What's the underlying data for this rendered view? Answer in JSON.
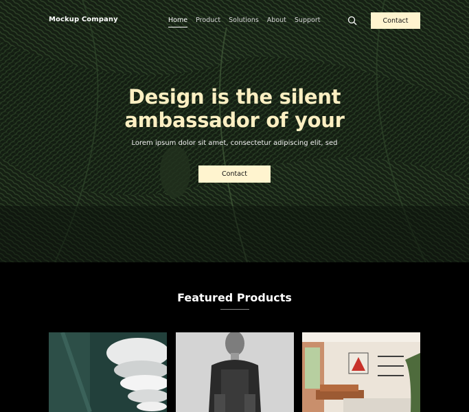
{
  "nav": {
    "brand": "Mockup Company",
    "items": [
      {
        "label": "Home",
        "active": true
      },
      {
        "label": "Product",
        "active": false
      },
      {
        "label": "Solutions",
        "active": false
      },
      {
        "label": "About",
        "active": false
      },
      {
        "label": "Support",
        "active": false
      }
    ],
    "search_icon": "search-icon",
    "contact_label": "Contact"
  },
  "hero": {
    "headline_line1": "Design is the silent",
    "headline_line2": "ambassador of your",
    "subtitle": "Lorem ipsum dolor sit amet, consectetur adipiscing elit, sed",
    "contact_label": "Contact"
  },
  "featured": {
    "title": "Featured Products",
    "products": [
      {
        "image": "pendant-lamp"
      },
      {
        "image": "person-portrait"
      },
      {
        "image": "living-room"
      }
    ]
  },
  "colors": {
    "accent": "#fff4cf",
    "headline": "#fcefc2",
    "background": "#000000",
    "fern": "#2f4a2a"
  }
}
